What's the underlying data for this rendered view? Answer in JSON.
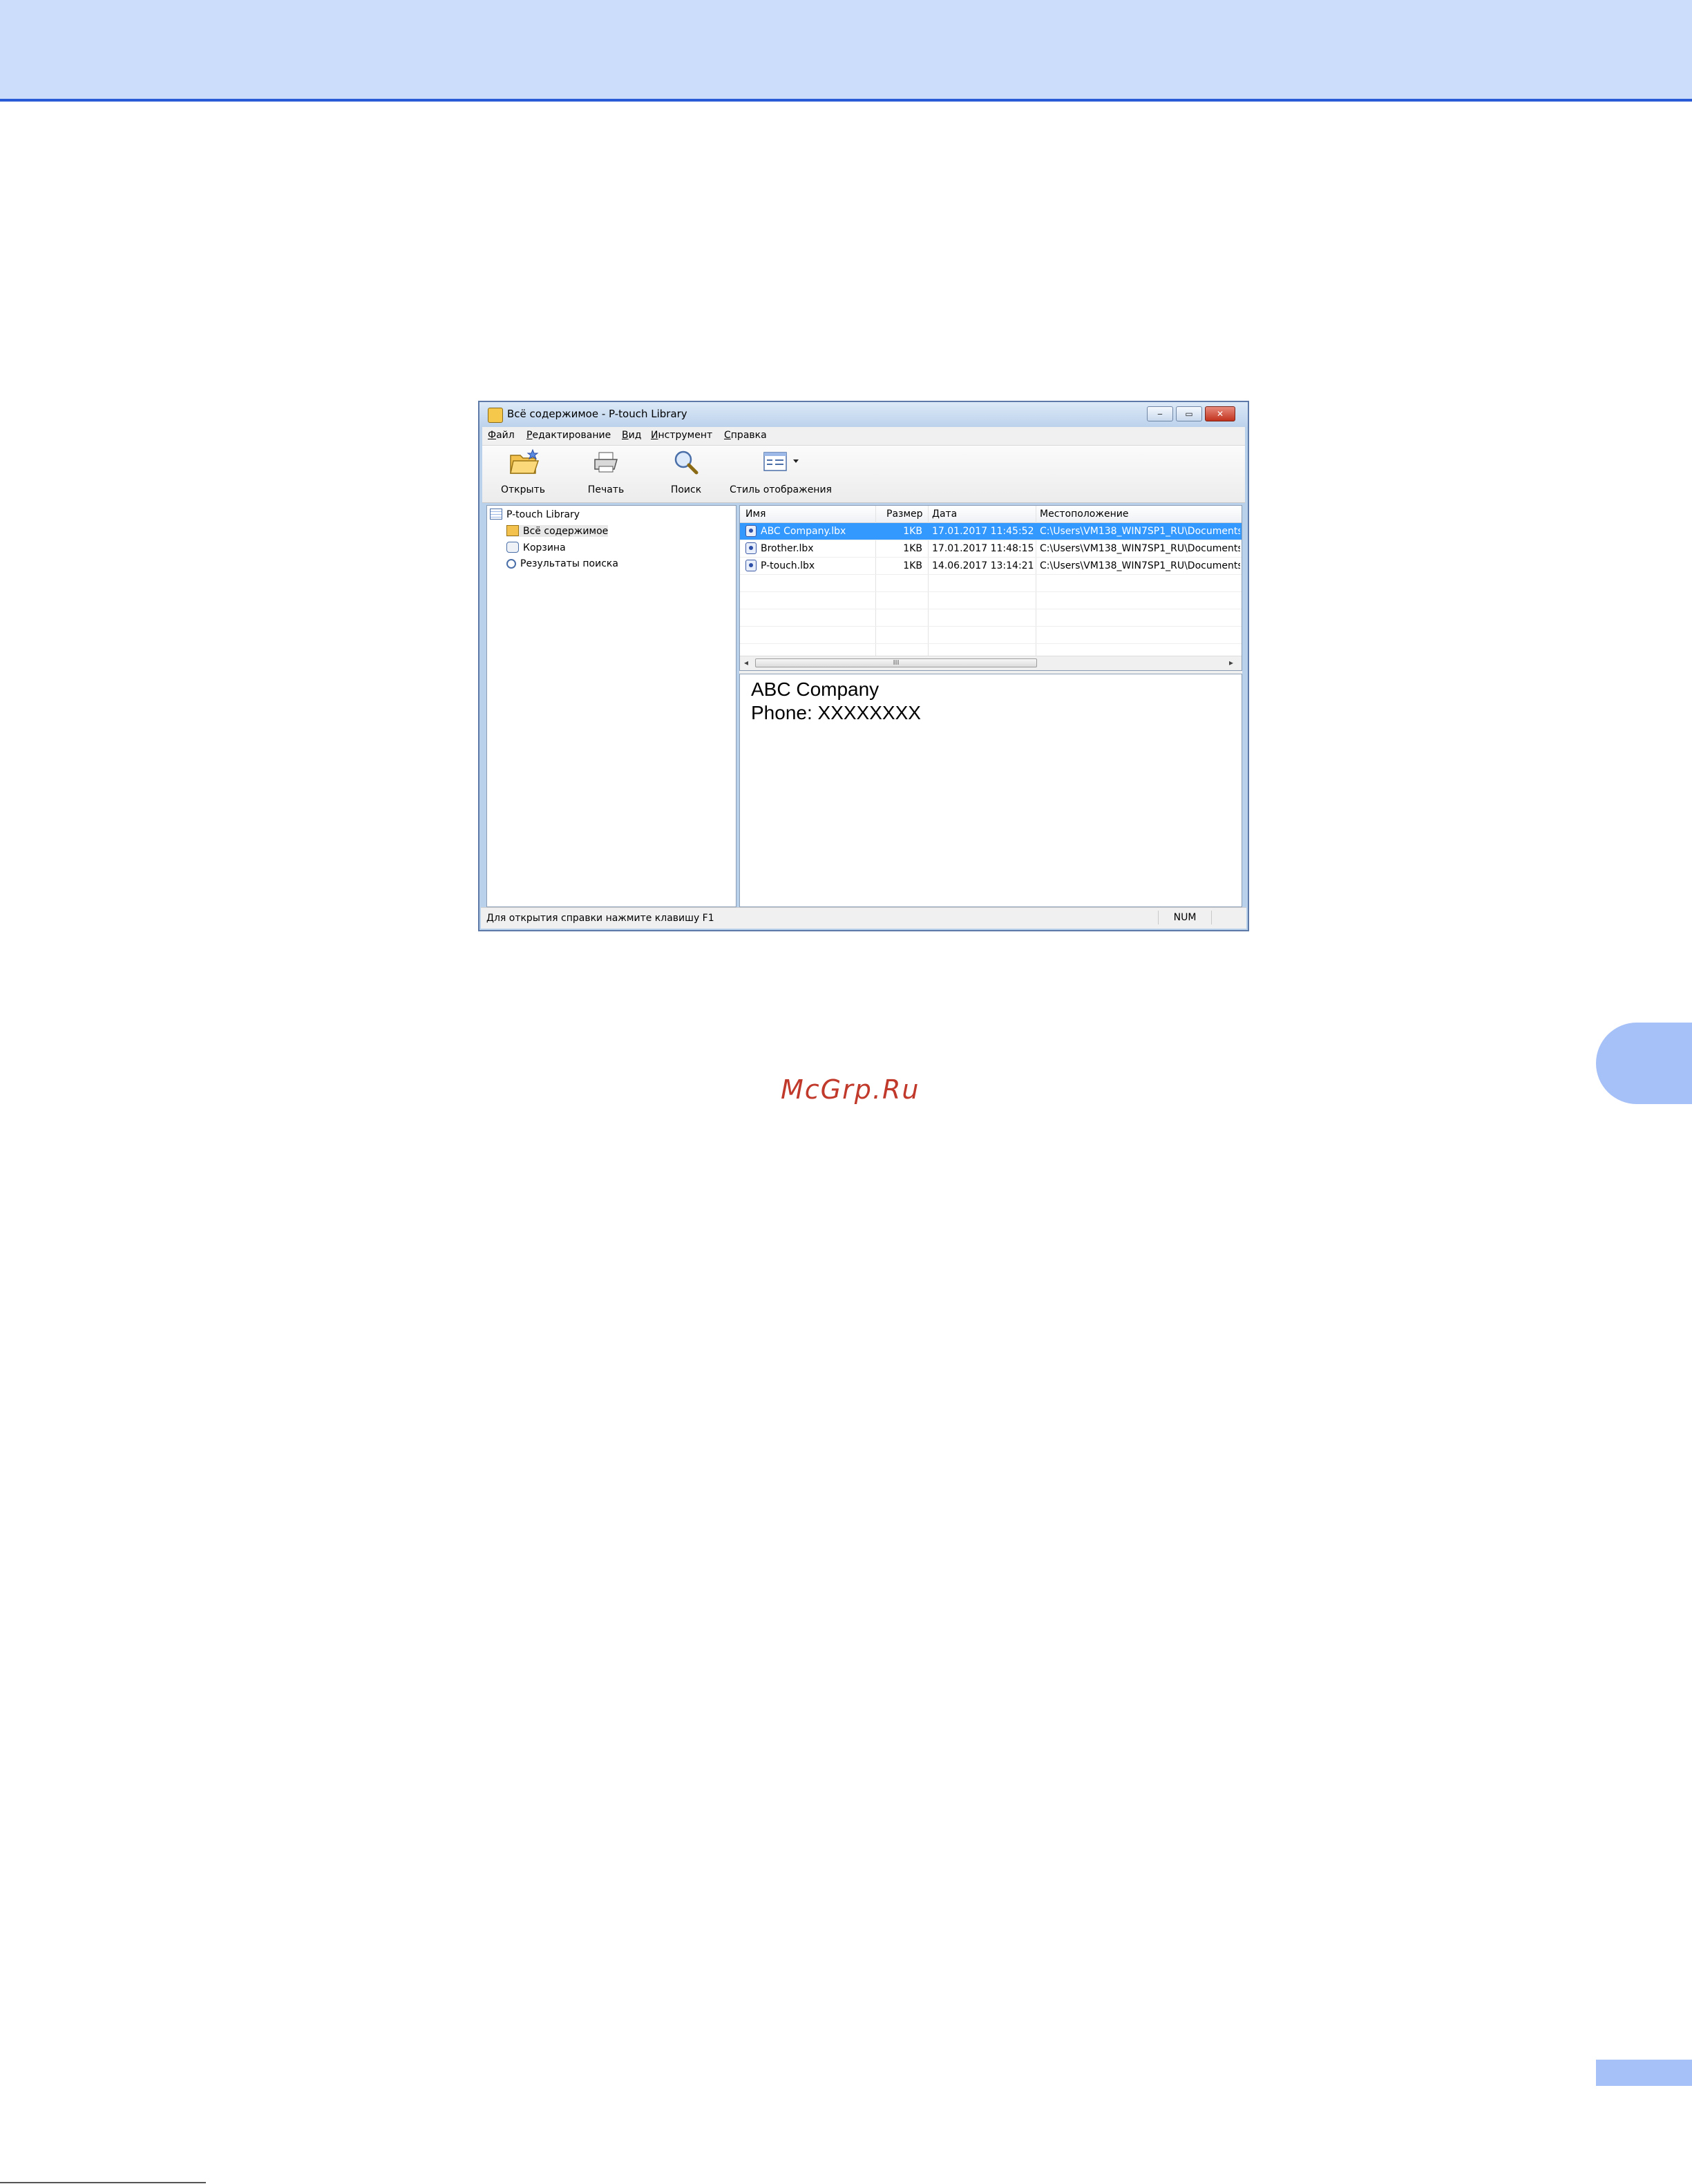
{
  "page": {
    "watermark": "McGrp.Ru"
  },
  "window": {
    "title": "Всё содержимое - P-touch Library",
    "controls": {
      "minimize": "‒",
      "maximize": "▭",
      "close": "✕"
    }
  },
  "menu": [
    {
      "accel": "Ф",
      "rest": "айл"
    },
    {
      "accel": "Р",
      "rest": "едактирование"
    },
    {
      "accel": "В",
      "rest": "ид"
    },
    {
      "accel": "И",
      "rest": "нструмент"
    },
    {
      "accel": "С",
      "rest": "правка"
    }
  ],
  "toolbar": {
    "open": "Открыть",
    "print": "Печать",
    "search": "Поиск",
    "view_style": "Стиль отображения"
  },
  "tree": {
    "root": "P-touch Library",
    "items": [
      "Всё содержимое",
      "Корзина",
      "Результаты поиска"
    ]
  },
  "list": {
    "columns": [
      "Имя",
      "Размер",
      "Дата",
      "Местоположение"
    ],
    "rows": [
      {
        "name": "ABC Company.lbx",
        "size": "1KB",
        "date": "17.01.2017 11:45:52",
        "location": "C:\\Users\\VM138_WIN7SP1_RU\\Documents"
      },
      {
        "name": "Brother.lbx",
        "size": "1KB",
        "date": "17.01.2017 11:48:15",
        "location": "C:\\Users\\VM138_WIN7SP1_RU\\Documents"
      },
      {
        "name": "P-touch.lbx",
        "size": "1KB",
        "date": "14.06.2017 13:14:21",
        "location": "C:\\Users\\VM138_WIN7SP1_RU\\Documents"
      }
    ],
    "scroll_grip": "III"
  },
  "preview": {
    "line1": "ABC Company",
    "line2": "Phone: XXXXXXXX"
  },
  "status": {
    "hint": "Для открытия справки нажмите клавишу F1",
    "num": "NUM"
  },
  "colors": {
    "header_band": "#ccdcfb",
    "accent_line": "#2a5bd7",
    "selection": "#3399ff",
    "watermark": "#c0392b"
  }
}
